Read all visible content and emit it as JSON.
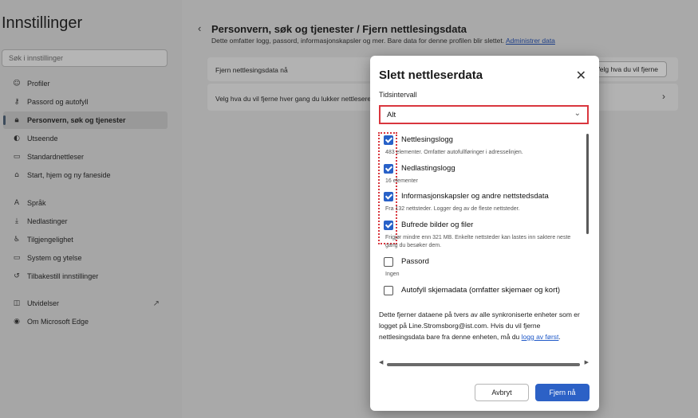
{
  "sidebar": {
    "title": "Innstillinger",
    "search_placeholder": "Søk i innstillinger",
    "items": [
      {
        "label": "Profiler",
        "icon": "person-icon"
      },
      {
        "label": "Passord og autofyll",
        "icon": "key-icon"
      },
      {
        "label": "Personvern, søk og tjenester",
        "icon": "lock-icon",
        "active": true
      },
      {
        "label": "Utseende",
        "icon": "palette-icon"
      },
      {
        "label": "Standardnettleser",
        "icon": "browser-icon"
      },
      {
        "label": "Start, hjem og ny faneside",
        "icon": "home-icon"
      },
      {
        "label": "Språk",
        "icon": "language-icon"
      },
      {
        "label": "Nedlastinger",
        "icon": "download-icon"
      },
      {
        "label": "Tilgjengelighet",
        "icon": "accessibility-icon"
      },
      {
        "label": "System og ytelse",
        "icon": "laptop-icon"
      },
      {
        "label": "Tilbakestill innstillinger",
        "icon": "reset-icon"
      },
      {
        "label": "Utvidelser",
        "icon": "puzzle-icon"
      },
      {
        "label": "Om Microsoft Edge",
        "icon": "edge-icon"
      }
    ]
  },
  "main": {
    "breadcrumb": "Personvern, søk og tjenester  /  Fjern nettlesingsdata",
    "description": "Dette omfatter logg, passord, informasjonskapsler og mer. Bare data for denne profilen blir slettet.",
    "manage_link": "Administrer data",
    "clear_now_label": "Fjern nettlesingsdata nå",
    "choose_button": "Velg hva du vil fjerne",
    "choose_every_time": "Velg hva du vil fjerne hver gang du lukker nettleseren"
  },
  "dialog": {
    "title": "Slett nettleserdata",
    "time_range_label": "Tidsintervall",
    "time_range_value": "Alt",
    "options": [
      {
        "title": "Nettlesingslogg",
        "desc": "483 elementer. Omfatter autofullføringer i adresselinjen.",
        "checked": true
      },
      {
        "title": "Nedlastingslogg",
        "desc": "16 elementer",
        "checked": true
      },
      {
        "title": "Informasjonskapsler og andre nettstedsdata",
        "desc": "Fra 132 nettsteder. Logger deg av de fleste nettsteder.",
        "checked": true
      },
      {
        "title": "Bufrede bilder og filer",
        "desc": "Frigjør mindre enn 321 MB. Enkelte nettsteder kan lastes inn saktere neste gang du besøker dem.",
        "checked": true
      },
      {
        "title": "Passord",
        "desc": "Ingen",
        "checked": false
      },
      {
        "title": "Autofyll skjemadata (omfatter skjemaer og kort)",
        "desc": "",
        "checked": false
      }
    ],
    "sync_note_pre": "Dette fjerner dataene på tvers av alle synkroniserte enheter som er logget på Line.Stromsborg@ist.com. Hvis du vil fjerne nettlesingsdata bare fra denne enheten, må du ",
    "sync_note_link": "logg av først",
    "sync_note_post": ".",
    "cancel_label": "Avbryt",
    "confirm_label": "Fjern nå"
  }
}
